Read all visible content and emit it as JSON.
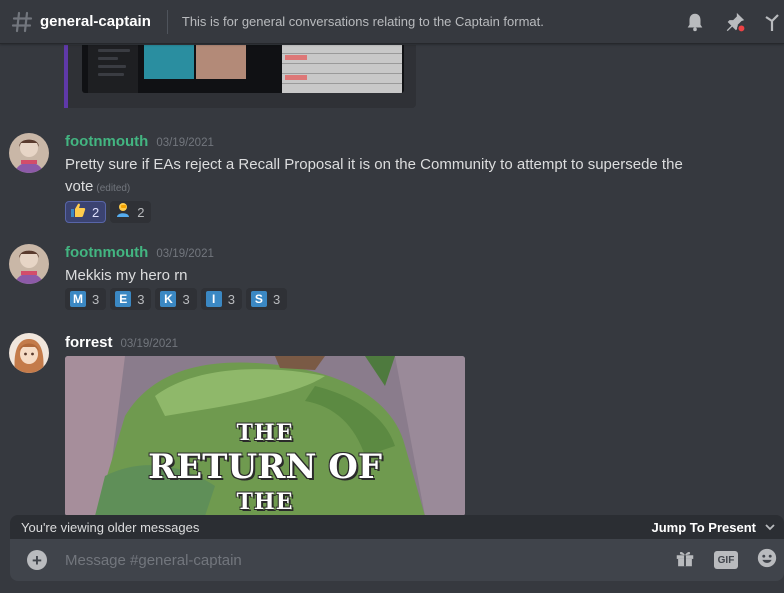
{
  "header": {
    "channel_name": "general-captain",
    "topic": "This is for general conversations relating to the Captain format.",
    "icons": [
      "hash-icon",
      "bell-icon",
      "pin-icon"
    ]
  },
  "messages": [
    {
      "username": "footnmouth",
      "username_color": "#43b581",
      "timestamp": "03/19/2021",
      "text": "Pretty sure if EAs reject a Recall Proposal it is on the Community to attempt to supersede the vote",
      "edited_label": "(edited)",
      "reactions": [
        {
          "emoji": "thumbs-up-icon",
          "count": "2",
          "reacted": true
        },
        {
          "emoji": "person-facepalm-icon",
          "count": "2",
          "reacted": false
        }
      ]
    },
    {
      "username": "footnmouth",
      "username_color": "#43b581",
      "timestamp": "03/19/2021",
      "text": "Mekkis my hero rn",
      "reactions": [
        {
          "emoji": "M",
          "count": "3"
        },
        {
          "emoji": "E",
          "count": "3"
        },
        {
          "emoji": "K",
          "count": "3"
        },
        {
          "emoji": "I",
          "count": "3"
        },
        {
          "emoji": "S",
          "count": "3"
        }
      ]
    },
    {
      "username": "forrest",
      "username_color": "#ffffff",
      "timestamp": "03/19/2021",
      "attachment": {
        "lines": [
          "THE",
          "RETURN OF",
          "THE"
        ]
      }
    }
  ],
  "older_bar": {
    "text": "You're viewing older messages",
    "jump_label": "Jump To Present"
  },
  "composer": {
    "placeholder": "Message #general-captain",
    "gif_label": "GIF"
  }
}
